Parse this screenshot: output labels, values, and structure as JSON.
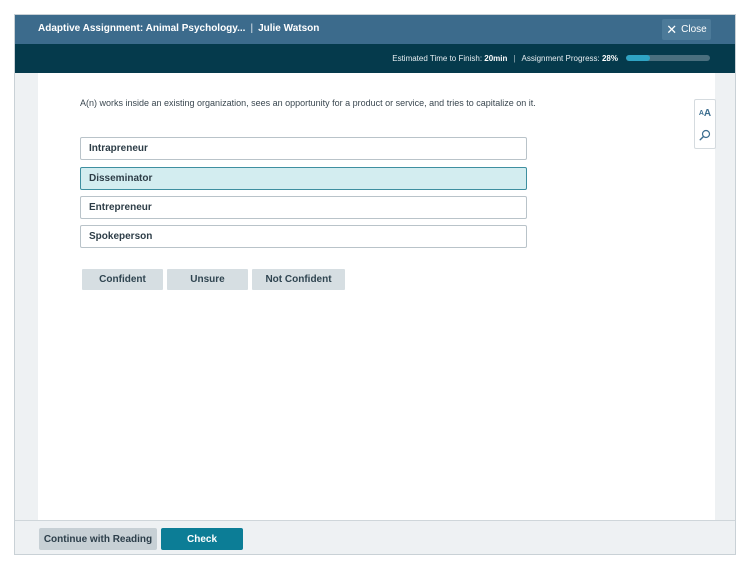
{
  "header": {
    "assignment_title": "Adaptive Assignment: Animal Psychology...",
    "separator": "|",
    "user_name": "Julie Watson",
    "close_label": "Close"
  },
  "status": {
    "time_label": "Estimated Time to Finish:",
    "time_value": "20min",
    "divider": "|",
    "progress_label": "Assignment Progress:",
    "progress_value": "28%",
    "progress_fraction": 0.28
  },
  "question": {
    "text": "A(n) works inside an existing organization, sees an opportunity for a product or service, and tries to capitalize on it.",
    "options": [
      {
        "label": "Intrapreneur",
        "selected": false
      },
      {
        "label": "Disseminator",
        "selected": true
      },
      {
        "label": "Entrepreneur",
        "selected": false
      },
      {
        "label": "Spokeperson",
        "selected": false
      }
    ]
  },
  "confidence": {
    "confident": "Confident",
    "unsure": "Unsure",
    "not_confident": "Not Confident"
  },
  "tools": {
    "text_size_large": "A",
    "text_size_small": "A",
    "zoom_icon": "magnifier-icon"
  },
  "footer": {
    "continue_label": "Continue with Reading",
    "check_label": "Check"
  },
  "colors": {
    "header_bg": "#3c6b8c",
    "status_bg": "#053a4c",
    "progress_fill": "#2fa4c4",
    "selected_bg": "#d3edf0",
    "check_bg": "#0c7d96"
  }
}
